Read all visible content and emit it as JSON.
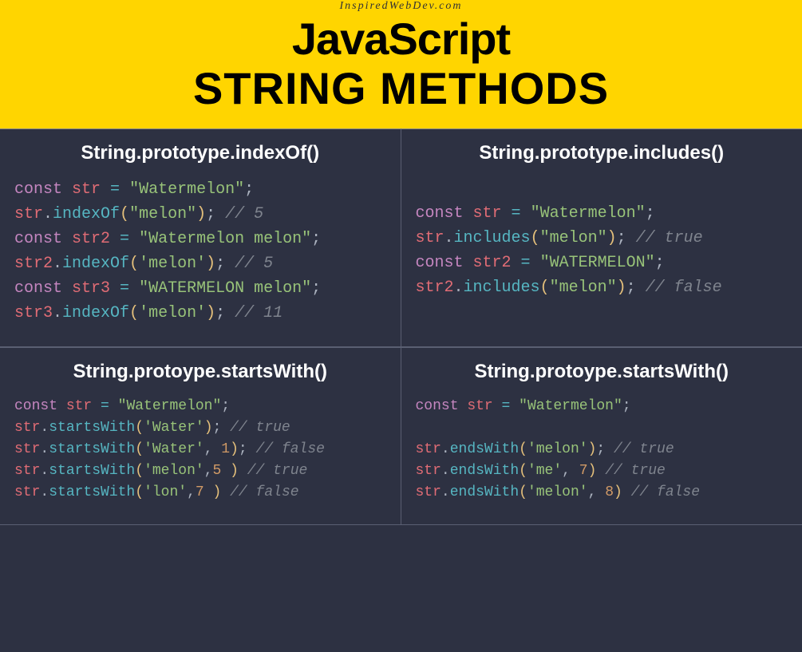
{
  "header": {
    "site": "InspiredWebDev.com",
    "title1": "JavaScript",
    "title2": "STRING METHODS"
  },
  "cells": [
    {
      "title": "String.prototype.indexOf()",
      "size": "big",
      "lines": [
        [
          [
            "kw",
            "const "
          ],
          [
            "varred",
            "str"
          ],
          [
            "punc",
            " "
          ],
          [
            "op",
            "="
          ],
          [
            "punc",
            " "
          ],
          [
            "str",
            "\"Watermelon\""
          ],
          [
            "punc",
            ";"
          ]
        ],
        [
          [
            "varred",
            "str"
          ],
          [
            "punc",
            "."
          ],
          [
            "fn",
            "indexOf"
          ],
          [
            "par",
            "("
          ],
          [
            "str",
            "\"melon\""
          ],
          [
            "par",
            ")"
          ],
          [
            "punc",
            ";"
          ],
          [
            "cmt",
            " // 5"
          ]
        ],
        [
          [
            "kw",
            "const "
          ],
          [
            "varred",
            "str2"
          ],
          [
            "punc",
            " "
          ],
          [
            "op",
            "="
          ],
          [
            "punc",
            " "
          ],
          [
            "str",
            "\"Watermelon melon\""
          ],
          [
            "punc",
            ";"
          ]
        ],
        [
          [
            "varred",
            "str2"
          ],
          [
            "punc",
            "."
          ],
          [
            "fn",
            "indexOf"
          ],
          [
            "par",
            "("
          ],
          [
            "str",
            "'melon'"
          ],
          [
            "par",
            ")"
          ],
          [
            "punc",
            ";"
          ],
          [
            "cmt",
            " // 5"
          ]
        ],
        [
          [
            "kw",
            "const "
          ],
          [
            "varred",
            "str3"
          ],
          [
            "punc",
            " "
          ],
          [
            "op",
            "="
          ],
          [
            "punc",
            " "
          ],
          [
            "str",
            "\"WATERMELON melon\""
          ],
          [
            "punc",
            ";"
          ]
        ],
        [
          [
            "varred",
            "str3"
          ],
          [
            "punc",
            "."
          ],
          [
            "fn",
            "indexOf"
          ],
          [
            "par",
            "("
          ],
          [
            "str",
            "'melon'"
          ],
          [
            "par",
            ")"
          ],
          [
            "punc",
            ";"
          ],
          [
            "cmt",
            " // 11"
          ]
        ]
      ]
    },
    {
      "title": "String.prototype.includes()",
      "size": "big",
      "lines": [
        [
          [
            "blank",
            ""
          ]
        ],
        [
          [
            "kw",
            "const "
          ],
          [
            "varred",
            "str"
          ],
          [
            "punc",
            " "
          ],
          [
            "op",
            "="
          ],
          [
            "punc",
            " "
          ],
          [
            "str",
            "\"Watermelon\""
          ],
          [
            "punc",
            ";"
          ]
        ],
        [
          [
            "varred",
            "str"
          ],
          [
            "punc",
            "."
          ],
          [
            "fn",
            "includes"
          ],
          [
            "par",
            "("
          ],
          [
            "str",
            "\"melon\""
          ],
          [
            "par",
            ")"
          ],
          [
            "punc",
            ";"
          ],
          [
            "cmt",
            " // true"
          ]
        ],
        [
          [
            "kw",
            "const "
          ],
          [
            "varred",
            "str2"
          ],
          [
            "punc",
            " "
          ],
          [
            "op",
            "="
          ],
          [
            "punc",
            " "
          ],
          [
            "str",
            "\"WATERMELON\""
          ],
          [
            "punc",
            ";"
          ]
        ],
        [
          [
            "varred",
            "str2"
          ],
          [
            "punc",
            "."
          ],
          [
            "fn",
            "includes"
          ],
          [
            "par",
            "("
          ],
          [
            "str",
            "\"melon\""
          ],
          [
            "par",
            ")"
          ],
          [
            "punc",
            ";"
          ],
          [
            "cmt",
            " // false"
          ]
        ]
      ]
    },
    {
      "title": "String.protoype.startsWith()",
      "size": "small",
      "lines": [
        [
          [
            "kw",
            "const "
          ],
          [
            "varred",
            "str"
          ],
          [
            "punc",
            " "
          ],
          [
            "op",
            "="
          ],
          [
            "punc",
            " "
          ],
          [
            "str",
            "\"Watermelon\""
          ],
          [
            "punc",
            ";"
          ]
        ],
        [
          [
            "varred",
            "str"
          ],
          [
            "punc",
            "."
          ],
          [
            "fn",
            "startsWith"
          ],
          [
            "par",
            "("
          ],
          [
            "str",
            "'Water'"
          ],
          [
            "par",
            ")"
          ],
          [
            "punc",
            ";"
          ],
          [
            "cmt",
            " // true"
          ]
        ],
        [
          [
            "varred",
            "str"
          ],
          [
            "punc",
            "."
          ],
          [
            "fn",
            "startsWith"
          ],
          [
            "par",
            "("
          ],
          [
            "str",
            "'Water'"
          ],
          [
            "punc",
            ", "
          ],
          [
            "num",
            "1"
          ],
          [
            "par",
            ")"
          ],
          [
            "punc",
            ";"
          ],
          [
            "cmt",
            " // false"
          ]
        ],
        [
          [
            "varred",
            "str"
          ],
          [
            "punc",
            "."
          ],
          [
            "fn",
            "startsWith"
          ],
          [
            "par",
            "("
          ],
          [
            "str",
            "'melon'"
          ],
          [
            "punc",
            ","
          ],
          [
            "num",
            "5"
          ],
          [
            "punc",
            " "
          ],
          [
            "par",
            ")"
          ],
          [
            "cmt",
            " // true"
          ]
        ],
        [
          [
            "varred",
            "str"
          ],
          [
            "punc",
            "."
          ],
          [
            "fn",
            "startsWith"
          ],
          [
            "par",
            "("
          ],
          [
            "str",
            "'lon'"
          ],
          [
            "punc",
            ","
          ],
          [
            "num",
            "7"
          ],
          [
            "punc",
            " "
          ],
          [
            "par",
            ")"
          ],
          [
            "cmt",
            " // false"
          ]
        ]
      ]
    },
    {
      "title": "String.protoype.startsWith()",
      "size": "small",
      "lines": [
        [
          [
            "kw",
            "const "
          ],
          [
            "varred",
            "str"
          ],
          [
            "punc",
            " "
          ],
          [
            "op",
            "="
          ],
          [
            "punc",
            " "
          ],
          [
            "str",
            "\"Watermelon\""
          ],
          [
            "punc",
            ";"
          ]
        ],
        [
          [
            "blank",
            ""
          ]
        ],
        [
          [
            "varred",
            "str"
          ],
          [
            "punc",
            "."
          ],
          [
            "fn",
            "endsWith"
          ],
          [
            "par",
            "("
          ],
          [
            "str",
            "'melon'"
          ],
          [
            "par",
            ")"
          ],
          [
            "punc",
            ";"
          ],
          [
            "cmt",
            " // true"
          ]
        ],
        [
          [
            "varred",
            "str"
          ],
          [
            "punc",
            "."
          ],
          [
            "fn",
            "endsWith"
          ],
          [
            "par",
            "("
          ],
          [
            "str",
            "'me'"
          ],
          [
            "punc",
            ", "
          ],
          [
            "num",
            "7"
          ],
          [
            "par",
            ")"
          ],
          [
            "cmt",
            " // true"
          ]
        ],
        [
          [
            "varred",
            "str"
          ],
          [
            "punc",
            "."
          ],
          [
            "fn",
            "endsWith"
          ],
          [
            "par",
            "("
          ],
          [
            "str",
            "'melon'"
          ],
          [
            "punc",
            ", "
          ],
          [
            "num",
            "8"
          ],
          [
            "par",
            ")"
          ],
          [
            "cmt",
            " // false"
          ]
        ]
      ]
    }
  ]
}
